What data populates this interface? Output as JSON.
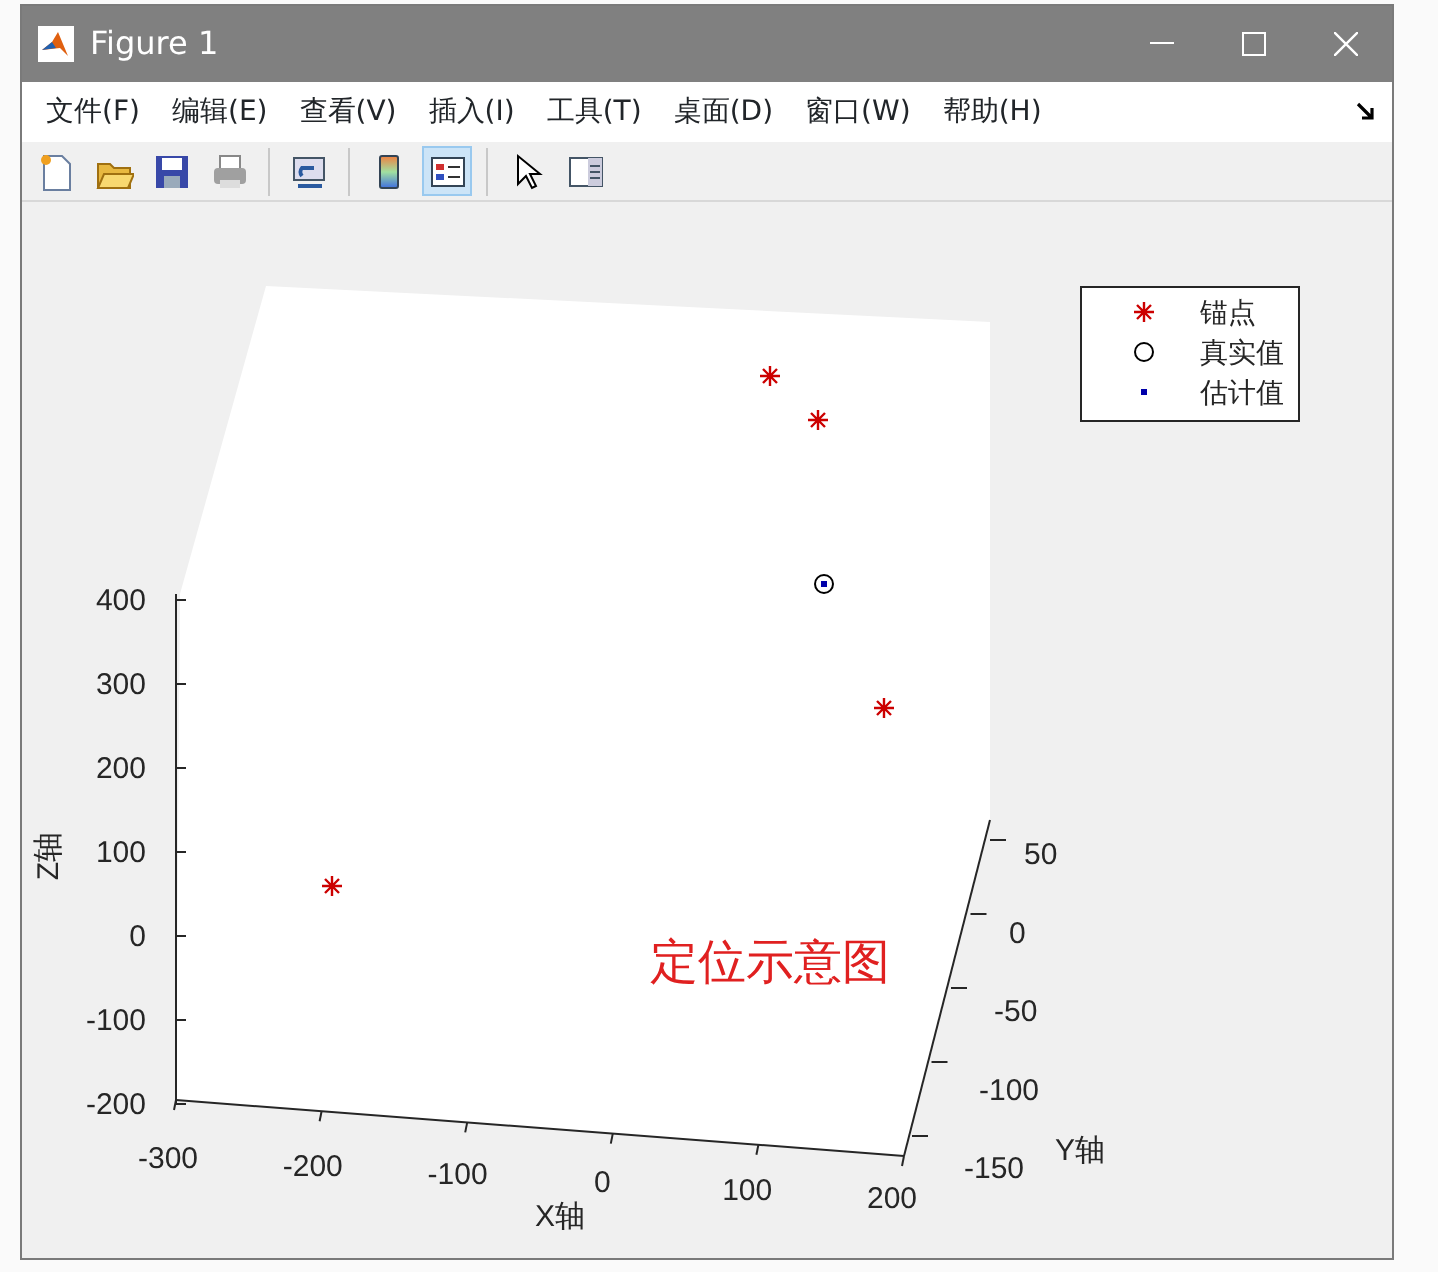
{
  "window": {
    "title": "Figure 1"
  },
  "menu": [
    "文件(F)",
    "编辑(E)",
    "查看(V)",
    "插入(I)",
    "工具(T)",
    "桌面(D)",
    "窗口(W)",
    "帮助(H)"
  ],
  "toolbar": [
    {
      "kind": "new",
      "selected": false
    },
    {
      "kind": "open",
      "selected": false
    },
    {
      "kind": "save",
      "selected": false
    },
    {
      "kind": "print",
      "selected": false
    },
    {
      "kind": "sep"
    },
    {
      "kind": "link",
      "selected": false
    },
    {
      "kind": "sep"
    },
    {
      "kind": "colorbar",
      "selected": false
    },
    {
      "kind": "legend",
      "selected": true
    },
    {
      "kind": "sep"
    },
    {
      "kind": "pointer",
      "selected": false
    },
    {
      "kind": "panel",
      "selected": false
    }
  ],
  "plot": {
    "annotation": "定位示意图",
    "x_axis": {
      "label": "X轴",
      "ticks": [
        "-300",
        "-200",
        "-100",
        "0",
        "100",
        "200"
      ]
    },
    "y_axis": {
      "label": "Y轴",
      "ticks": [
        "50",
        "0",
        "-50",
        "-100",
        "-150"
      ]
    },
    "z_axis": {
      "label": "Z轴",
      "ticks": [
        "400",
        "300",
        "200",
        "100",
        "0",
        "-100",
        "-200"
      ]
    },
    "legend": [
      {
        "kind": "star",
        "label": "锚点",
        "color": "#cc0000"
      },
      {
        "kind": "circle",
        "label": "真实值",
        "color": "#000000"
      },
      {
        "kind": "dot",
        "label": "估计值",
        "color": "#0000aa"
      }
    ]
  }
}
